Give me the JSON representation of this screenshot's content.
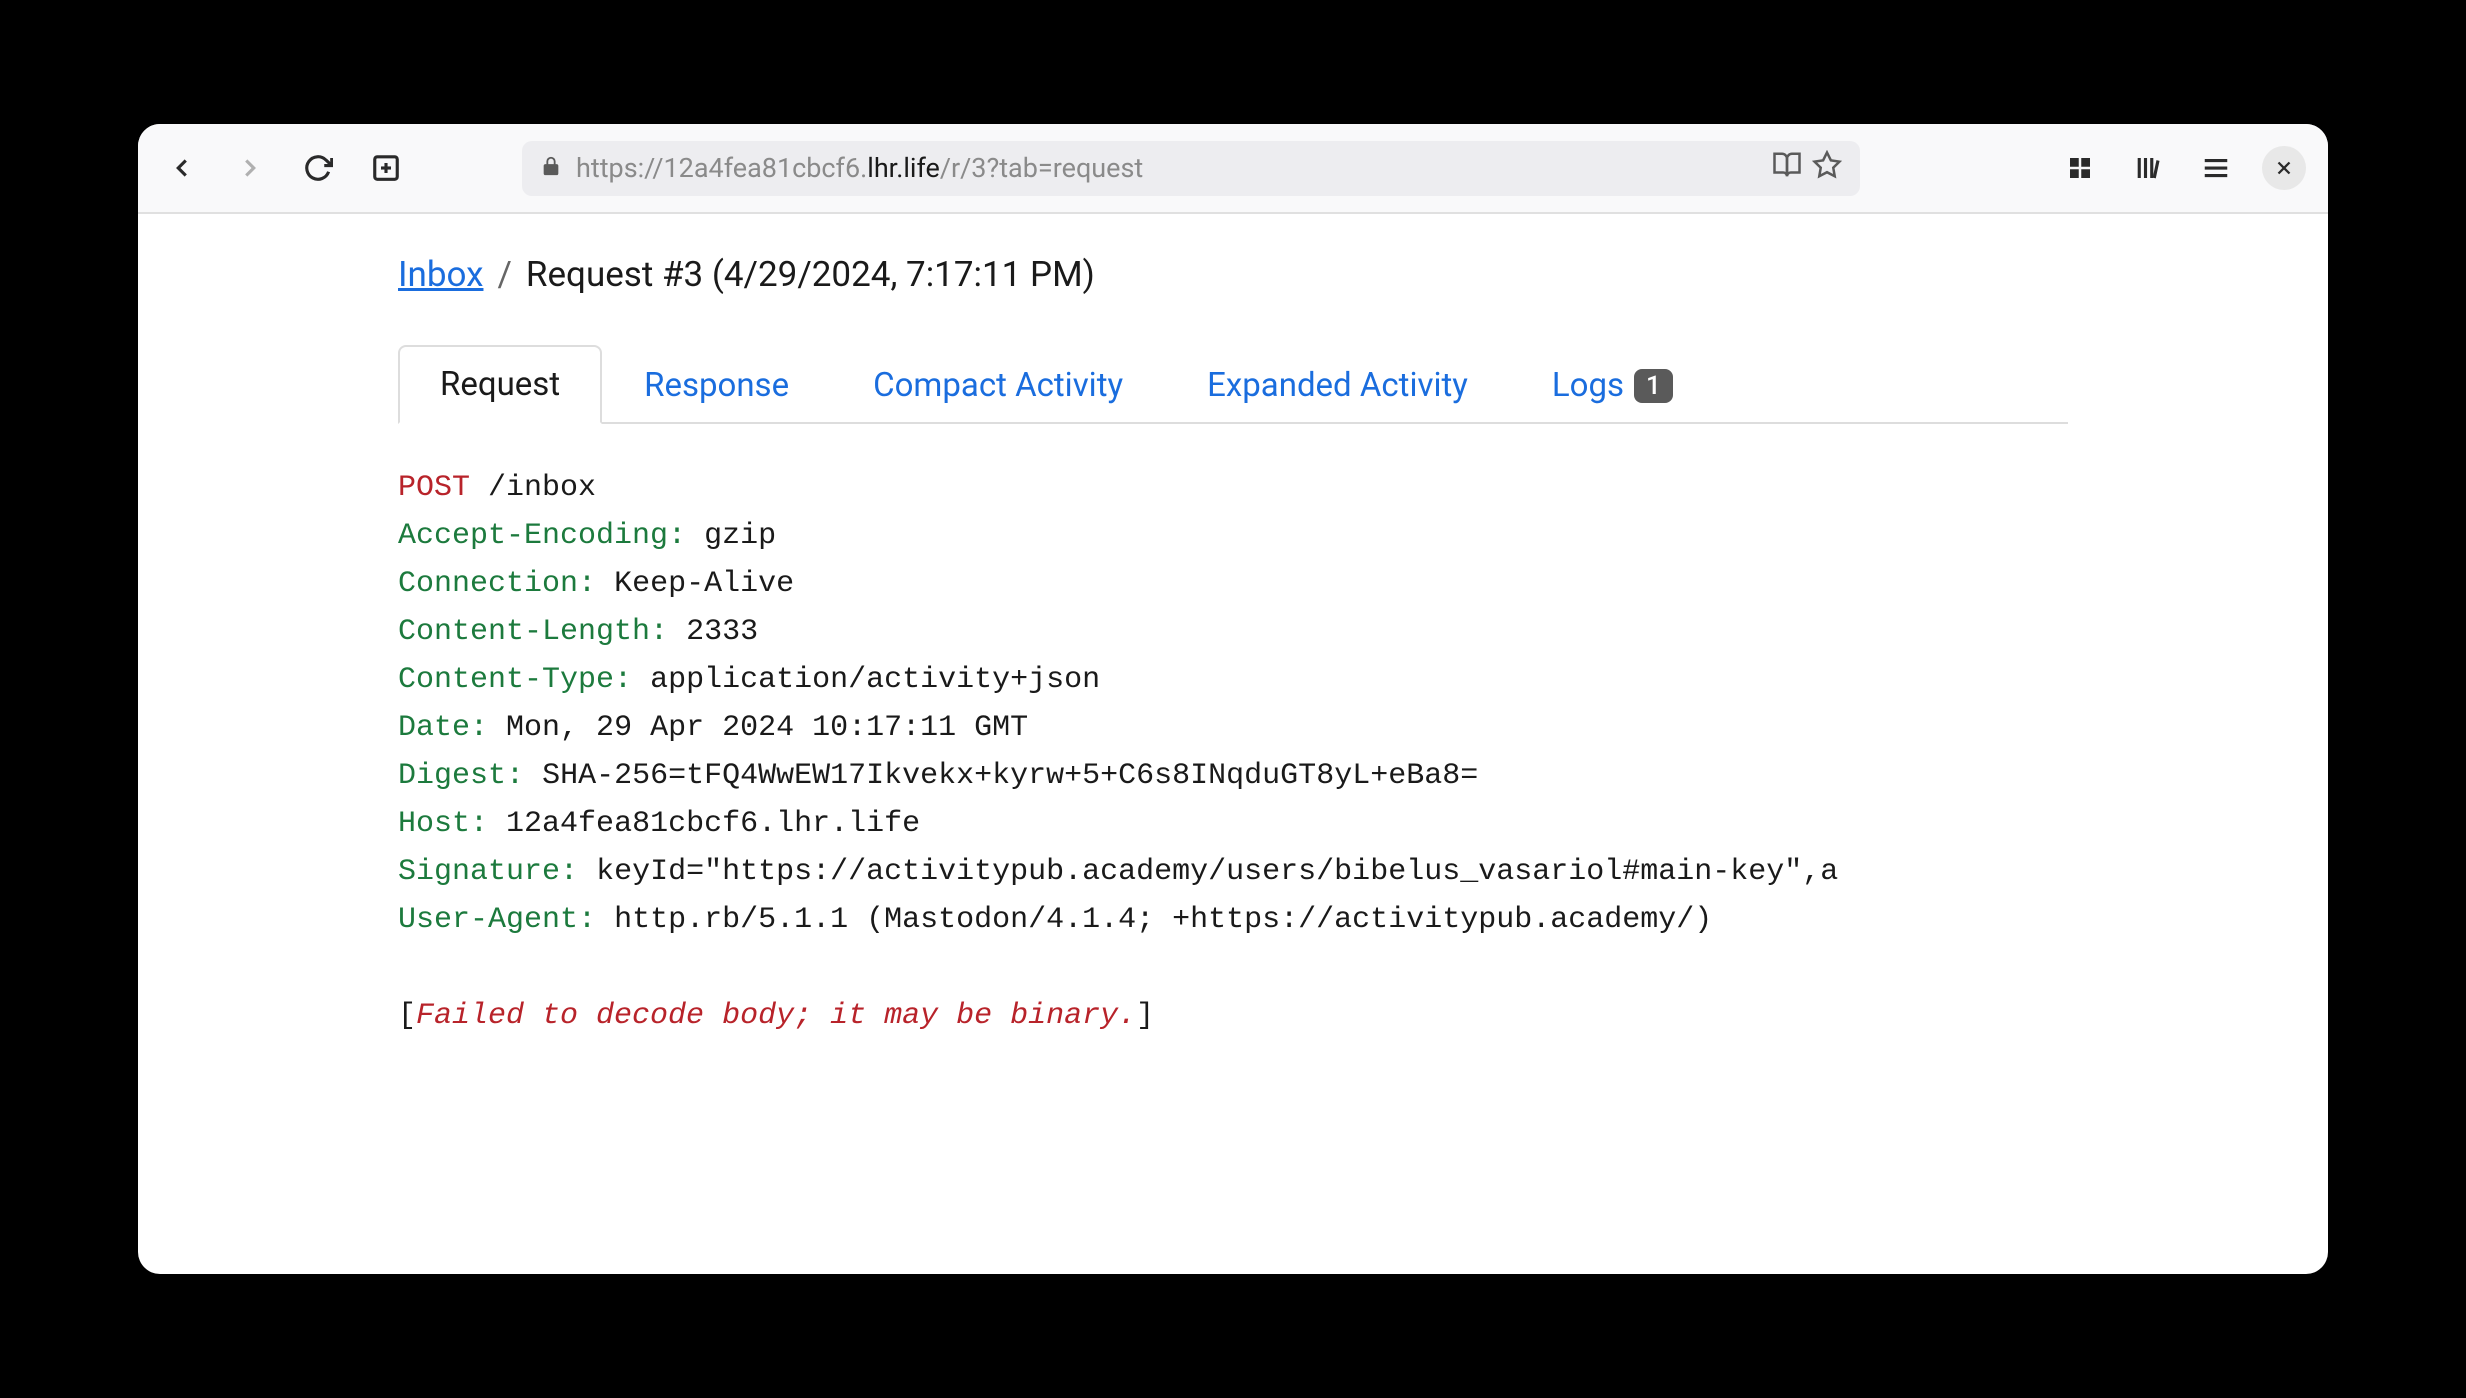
{
  "url": {
    "proto": "https://",
    "subdomain": "12a4fea81cbcf6.",
    "host": "lhr.life",
    "path": "/r/3?tab=request"
  },
  "breadcrumb": {
    "link": "Inbox",
    "current": "Request #3 (4/29/2024, 7:17:11 PM)"
  },
  "tabs": [
    {
      "label": "Request",
      "active": true
    },
    {
      "label": "Response",
      "active": false
    },
    {
      "label": "Compact Activity",
      "active": false
    },
    {
      "label": "Expanded Activity",
      "active": false
    },
    {
      "label": "Logs",
      "active": false,
      "badge": "1"
    }
  ],
  "request": {
    "method": "POST",
    "path": "/inbox",
    "headers": [
      {
        "key": "Accept-Encoding",
        "value": "gzip"
      },
      {
        "key": "Connection",
        "value": "Keep-Alive"
      },
      {
        "key": "Content-Length",
        "value": "2333"
      },
      {
        "key": "Content-Type",
        "value": "application/activity+json"
      },
      {
        "key": "Date",
        "value": "Mon, 29 Apr 2024 10:17:11 GMT"
      },
      {
        "key": "Digest",
        "value": "SHA-256=tFQ4WwEW17Ikvekx+kyrw+5+C6s8INqduGT8yL+eBa8="
      },
      {
        "key": "Host",
        "value": "12a4fea81cbcf6.lhr.life"
      },
      {
        "key": "Signature",
        "value": "keyId=\"https://activitypub.academy/users/bibelus_vasariol#main-key\",a"
      },
      {
        "key": "User-Agent",
        "value": "http.rb/5.1.1 (Mastodon/4.1.4; +https://activitypub.academy/)"
      }
    ],
    "body_message": "Failed to decode body; it may be binary."
  }
}
